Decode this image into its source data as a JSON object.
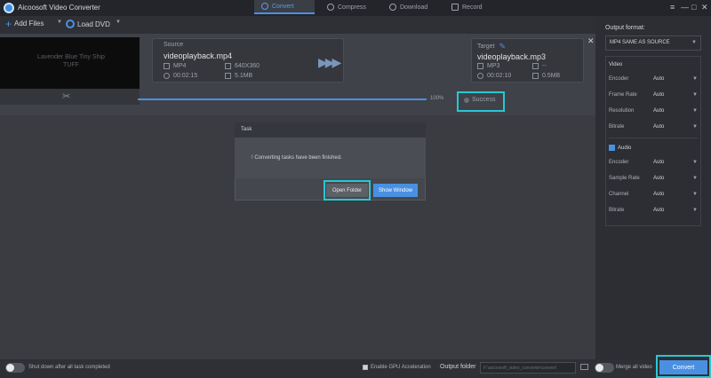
{
  "app": {
    "title": "Aicoosoft Video Converter"
  },
  "tabs": [
    {
      "label": "Convert"
    },
    {
      "label": "Compress"
    },
    {
      "label": "Download"
    },
    {
      "label": "Record"
    }
  ],
  "window_controls": {
    "menu": "≡",
    "minimize": "—",
    "maximize": "□",
    "close": "✕"
  },
  "toolbar": {
    "add_files": "Add Files",
    "load_dvd": "Load DVD"
  },
  "task": {
    "thumb_text": "Lavender Blue Tiny Ship\nTUFF",
    "source_label": "Source",
    "source_file": "videoplayback.mp4",
    "source_format": "MP4",
    "source_resolution": "640X360",
    "source_duration": "00:02:15",
    "source_size": "5.1MB",
    "target_label": "Target",
    "target_file": "videoplayback.mp3",
    "target_format": "MP3",
    "target_resolution": "--",
    "target_duration": "00:02:10",
    "target_size": "0.5MB",
    "progress_text": "100%",
    "progress_value": 1.0,
    "status": "Success"
  },
  "dialog": {
    "title": "Task",
    "message": "Converting tasks have been finished.",
    "open_folder": "Open Folder",
    "show_window": "Show Window"
  },
  "right_panel": {
    "output_format_label": "Output format:",
    "output_format_value": "MP4 SAME AS SOURCE",
    "video_title": "Video",
    "video_rows": [
      {
        "label": "Encoder",
        "value": "Auto"
      },
      {
        "label": "Frame Rate",
        "value": "Auto"
      },
      {
        "label": "Resolution",
        "value": "Auto"
      },
      {
        "label": "Bitrate",
        "value": "Auto"
      }
    ],
    "audio_title": "Audio",
    "audio_rows": [
      {
        "label": "Encoder",
        "value": "Auto"
      },
      {
        "label": "Sample Rate",
        "value": "Auto"
      },
      {
        "label": "Channel",
        "value": "Auto"
      },
      {
        "label": "Bitrate",
        "value": "Auto"
      }
    ]
  },
  "bottom": {
    "shutdown_text": "Shut down after all task completed",
    "gpu_text": "Enable GPU Acceleration",
    "output_folder_label": "Output folder",
    "output_folder_path": "F:\\aicoosoft_video_converter\\convert",
    "merge_text": "Merge all video",
    "convert_button": "Convert"
  },
  "colors": {
    "accent": "#4a90e2",
    "highlight": "#29c7d3",
    "background": "#3a3c42"
  }
}
